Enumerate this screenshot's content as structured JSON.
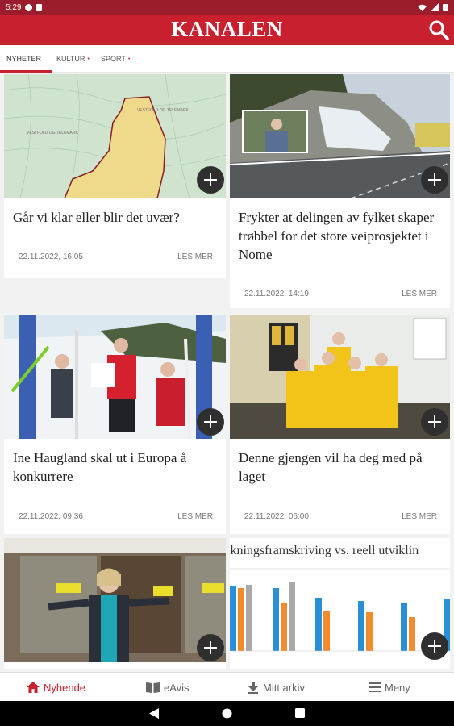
{
  "status_bar": {
    "time": "5:29"
  },
  "app": {
    "title": "KANALEN",
    "brand_color": "#c8202f"
  },
  "tabs": [
    {
      "label": "NYHETER",
      "active": true
    },
    {
      "label": "KULTUR",
      "active": false
    },
    {
      "label": "SPORT",
      "active": false
    }
  ],
  "articles": [
    {
      "title": "Går vi klar eller blir det uvær?",
      "date": "22.11.2022, 16:05",
      "read_more": "LES MER",
      "map_labels": [
        "VESTFOLD OG TELEMARK",
        "VESTFOLD OG TELEMARK"
      ]
    },
    {
      "title": "Frykter at delingen av fylket skaper trøbbel for det store veiprosjektet i Nome",
      "date": "22.11.2022, 14:19",
      "read_more": "LES MER"
    },
    {
      "title": "Ine Haugland skal ut i Europa å konkurrere",
      "date": "22.11.2022, 09:36",
      "read_more": "LES MER"
    },
    {
      "title": "Denne gjengen vil ha deg med på laget",
      "date": "22.11.2022, 06:00",
      "read_more": "LES MER"
    },
    {
      "title": "",
      "date": "",
      "read_more": ""
    },
    {
      "title": "",
      "date": "",
      "read_more": "",
      "image_heading": "lkningsframskriving vs. reell utviklin"
    }
  ],
  "bottom_nav": [
    {
      "label": "Nyhende",
      "icon": "home-icon",
      "active": true
    },
    {
      "label": "eAvis",
      "icon": "book-icon",
      "active": false
    },
    {
      "label": "Mitt arkiv",
      "icon": "download-icon",
      "active": false
    },
    {
      "label": "Meny",
      "icon": "menu-icon",
      "active": false
    }
  ]
}
